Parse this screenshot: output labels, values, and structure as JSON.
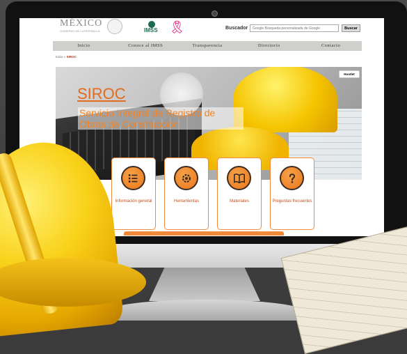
{
  "header": {
    "logo_text": "MÉXICO",
    "logo_subtext": "GOBIERNO DE LA REPÚBLICA",
    "imss_text": "IMSS",
    "ribbon_glyph": "🎗",
    "search_label": "Buscador",
    "search_placeholder": "Google  Búsqueda personalizada de Google",
    "search_button": "Buscar"
  },
  "nav": {
    "items": [
      "Inicio",
      "Conoce al IMSS",
      "Transparencia",
      "Directorio",
      "Contacto"
    ]
  },
  "breadcrumb": {
    "home": "Inicio",
    "separator": " » ",
    "current": "SIROC"
  },
  "hero": {
    "title": "SIROC",
    "subtitle": "Servicio Integral de Registro de Obras de Construcción",
    "hootlet": "Hootlet"
  },
  "cards": [
    {
      "icon": "list-icon",
      "label": "Información general"
    },
    {
      "icon": "gear-icon",
      "label": "Herramientas"
    },
    {
      "icon": "book-icon",
      "label": "Materiales"
    },
    {
      "icon": "question-icon",
      "label": "Preguntas frecuentes"
    }
  ],
  "colors": {
    "accent": "#e8761a",
    "nav_bg": "#cfd0cc",
    "imss_green": "#1f6b50",
    "ribbon_pink": "#e2006f"
  }
}
